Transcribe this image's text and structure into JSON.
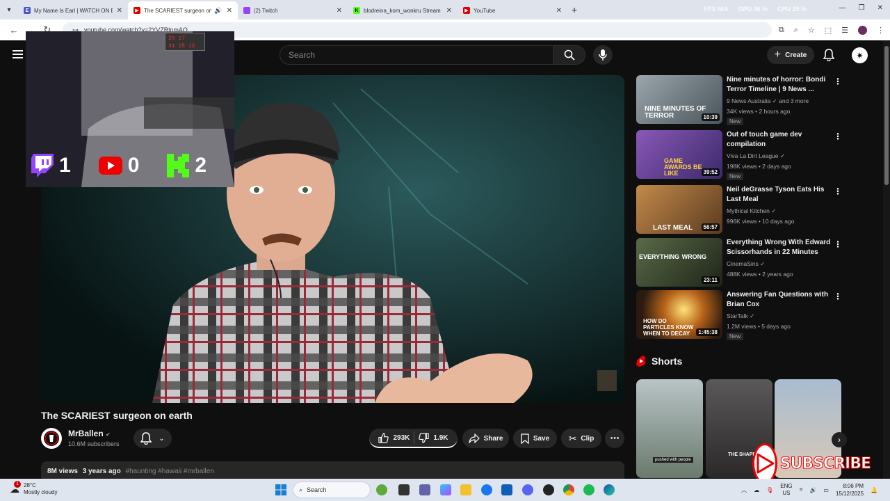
{
  "browser": {
    "tabs": [
      {
        "title": "My Name Is Earl | WATCH ON B",
        "favicon_color": "#4a55c8"
      },
      {
        "title": "The SCARIEST surgeon on e",
        "favicon_color": "#e00000",
        "active": true
      },
      {
        "title": "(2) Twitch",
        "favicon_color": "#9146ff"
      },
      {
        "title": "blodreina_kom_wonkru Stream",
        "favicon_color": "#53fc18"
      },
      {
        "title": "YouTube",
        "favicon_color": "#e00000"
      }
    ],
    "perf": [
      "FPS N/A",
      "GPU 36 %",
      "CPU 25 %",
      "RAM N/A"
    ],
    "url": "youtube.com/watch?v=2YVZRlpmAQ"
  },
  "header": {
    "search_placeholder": "Search",
    "create_label": "Create"
  },
  "overlay": {
    "clock_line1": "20 17",
    "clock_line2": "31   15   12",
    "twitch_count": "1",
    "youtube_count": "0",
    "kick_count": "2"
  },
  "video": {
    "title": "The SCARIEST surgeon on earth",
    "channel": "MrBallen",
    "subscribers": "10.6M subscribers",
    "likes": "293K",
    "dislikes": "1.9K",
    "share_label": "Share",
    "save_label": "Save",
    "clip_label": "Clip",
    "views": "8M views",
    "age": "3 years ago",
    "tags": "#haunting #hawaii #mrballen"
  },
  "recommendations": [
    {
      "title": "Nine minutes of horror: Bondi Terror Timeline | 9 News ...",
      "channel": "9 News Australia  ✓ and 3 more",
      "meta": "34K views • 2 hours ago",
      "duration": "10:39",
      "badge": "New",
      "thumb_text": "NINE MINUTES OF TERROR",
      "color": "#6f7c86"
    },
    {
      "title": "Out of touch game dev compilation",
      "channel": "Viva La Dirt League  ✓",
      "meta": "198K views • 2 days ago",
      "duration": "39:52",
      "badge": "New",
      "thumb_text": "GAME AWARDS BE LIKE",
      "color": "#7a4aa0"
    },
    {
      "title": "Neil deGrasse Tyson Eats His Last Meal",
      "channel": "Mythical Kitchen  ✓",
      "meta": "996K views • 10 days ago",
      "duration": "56:57",
      "badge": "",
      "thumb_text": "LAST MEAL",
      "color": "#a66a3a"
    },
    {
      "title": "Everything Wrong With Edward Scissorhands in 22 Minutes or...",
      "channel": "CinemaSins  ✓",
      "meta": "488K views • 2 years ago",
      "duration": "23:11",
      "badge": "",
      "thumb_text": "EVERYTHING WRONG WITH Edward Scissorh",
      "color": "#3f4a36"
    },
    {
      "title": "Answering Fan Questions with Brian Cox",
      "channel": "StarTalk  ✓",
      "meta": "1.2M views • 5 days ago",
      "duration": "1:45:38",
      "badge": "New",
      "thumb_text": "HOW DO PARTICLES KNOW WHEN TO DECAY",
      "color": "#5a3a20"
    }
  ],
  "shorts": {
    "heading": "Shorts",
    "items": [
      {
        "color": "#7b8a8c",
        "caption": "pushed with people"
      },
      {
        "color": "#3b3a3a",
        "caption": "THE SHAPE"
      },
      {
        "color": "#8aa0b8",
        "caption": ""
      }
    ]
  },
  "subscribe_label": "SUBSCRIBE",
  "taskbar": {
    "temp": "28°C",
    "weather": "Mostly cloudy",
    "search_label": "Search",
    "lang1": "ENG",
    "lang2": "US",
    "time": "8:06 PM",
    "date": "15/12/2025",
    "weather_badge": "1"
  }
}
